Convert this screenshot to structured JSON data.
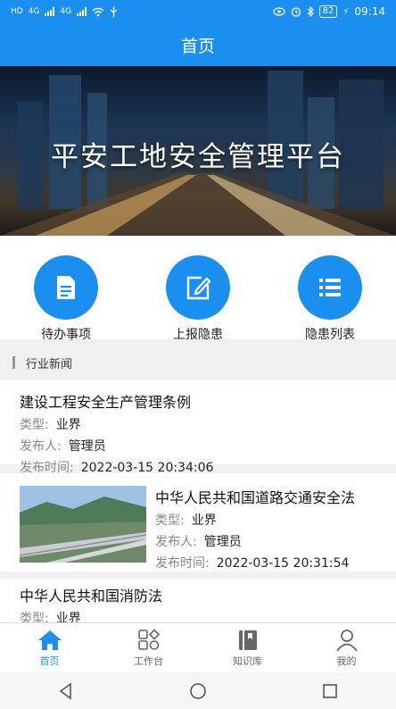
{
  "status_bar": {
    "left_labels": [
      "HD",
      "4G",
      "4G"
    ],
    "battery": "82",
    "time": "09:14",
    "icons": [
      "eye-icon",
      "alarm-icon",
      "bluetooth-icon",
      "battery-icon",
      "charging-icon"
    ]
  },
  "header": {
    "title": "首页"
  },
  "banner": {
    "title": "平安工地安全管理平台"
  },
  "quick_actions": [
    {
      "label": "待办事项",
      "icon": "document-icon"
    },
    {
      "label": "上报隐患",
      "icon": "edit-icon"
    },
    {
      "label": "隐患列表",
      "icon": "list-icon"
    }
  ],
  "section": {
    "title": "行业新闻"
  },
  "news": [
    {
      "title": "建设工程安全生产管理条例",
      "type_label": "类型:",
      "type": "业界",
      "publisher_label": "发布人:",
      "publisher": "管理员",
      "time_label": "发布时间:",
      "time": "2022-03-15 20:34:06"
    },
    {
      "title": "中华人民共和国道路交通安全法",
      "type_label": "类型:",
      "type": "业界",
      "publisher_label": "发布人:",
      "publisher": "管理员",
      "time_label": "发布时间:",
      "time": "2022-03-15 20:31:54"
    },
    {
      "title": "中华人民共和国消防法",
      "type_label": "类型:",
      "type": "业界"
    }
  ],
  "tabs": [
    {
      "label": "首页",
      "icon": "home-icon",
      "active": true
    },
    {
      "label": "工作台",
      "icon": "grid-icon",
      "active": false
    },
    {
      "label": "知识库",
      "icon": "book-icon",
      "active": false
    },
    {
      "label": "我的",
      "icon": "user-icon",
      "active": false
    }
  ],
  "colors": {
    "primary": "#1a8ff0",
    "label_gray": "#888888"
  }
}
